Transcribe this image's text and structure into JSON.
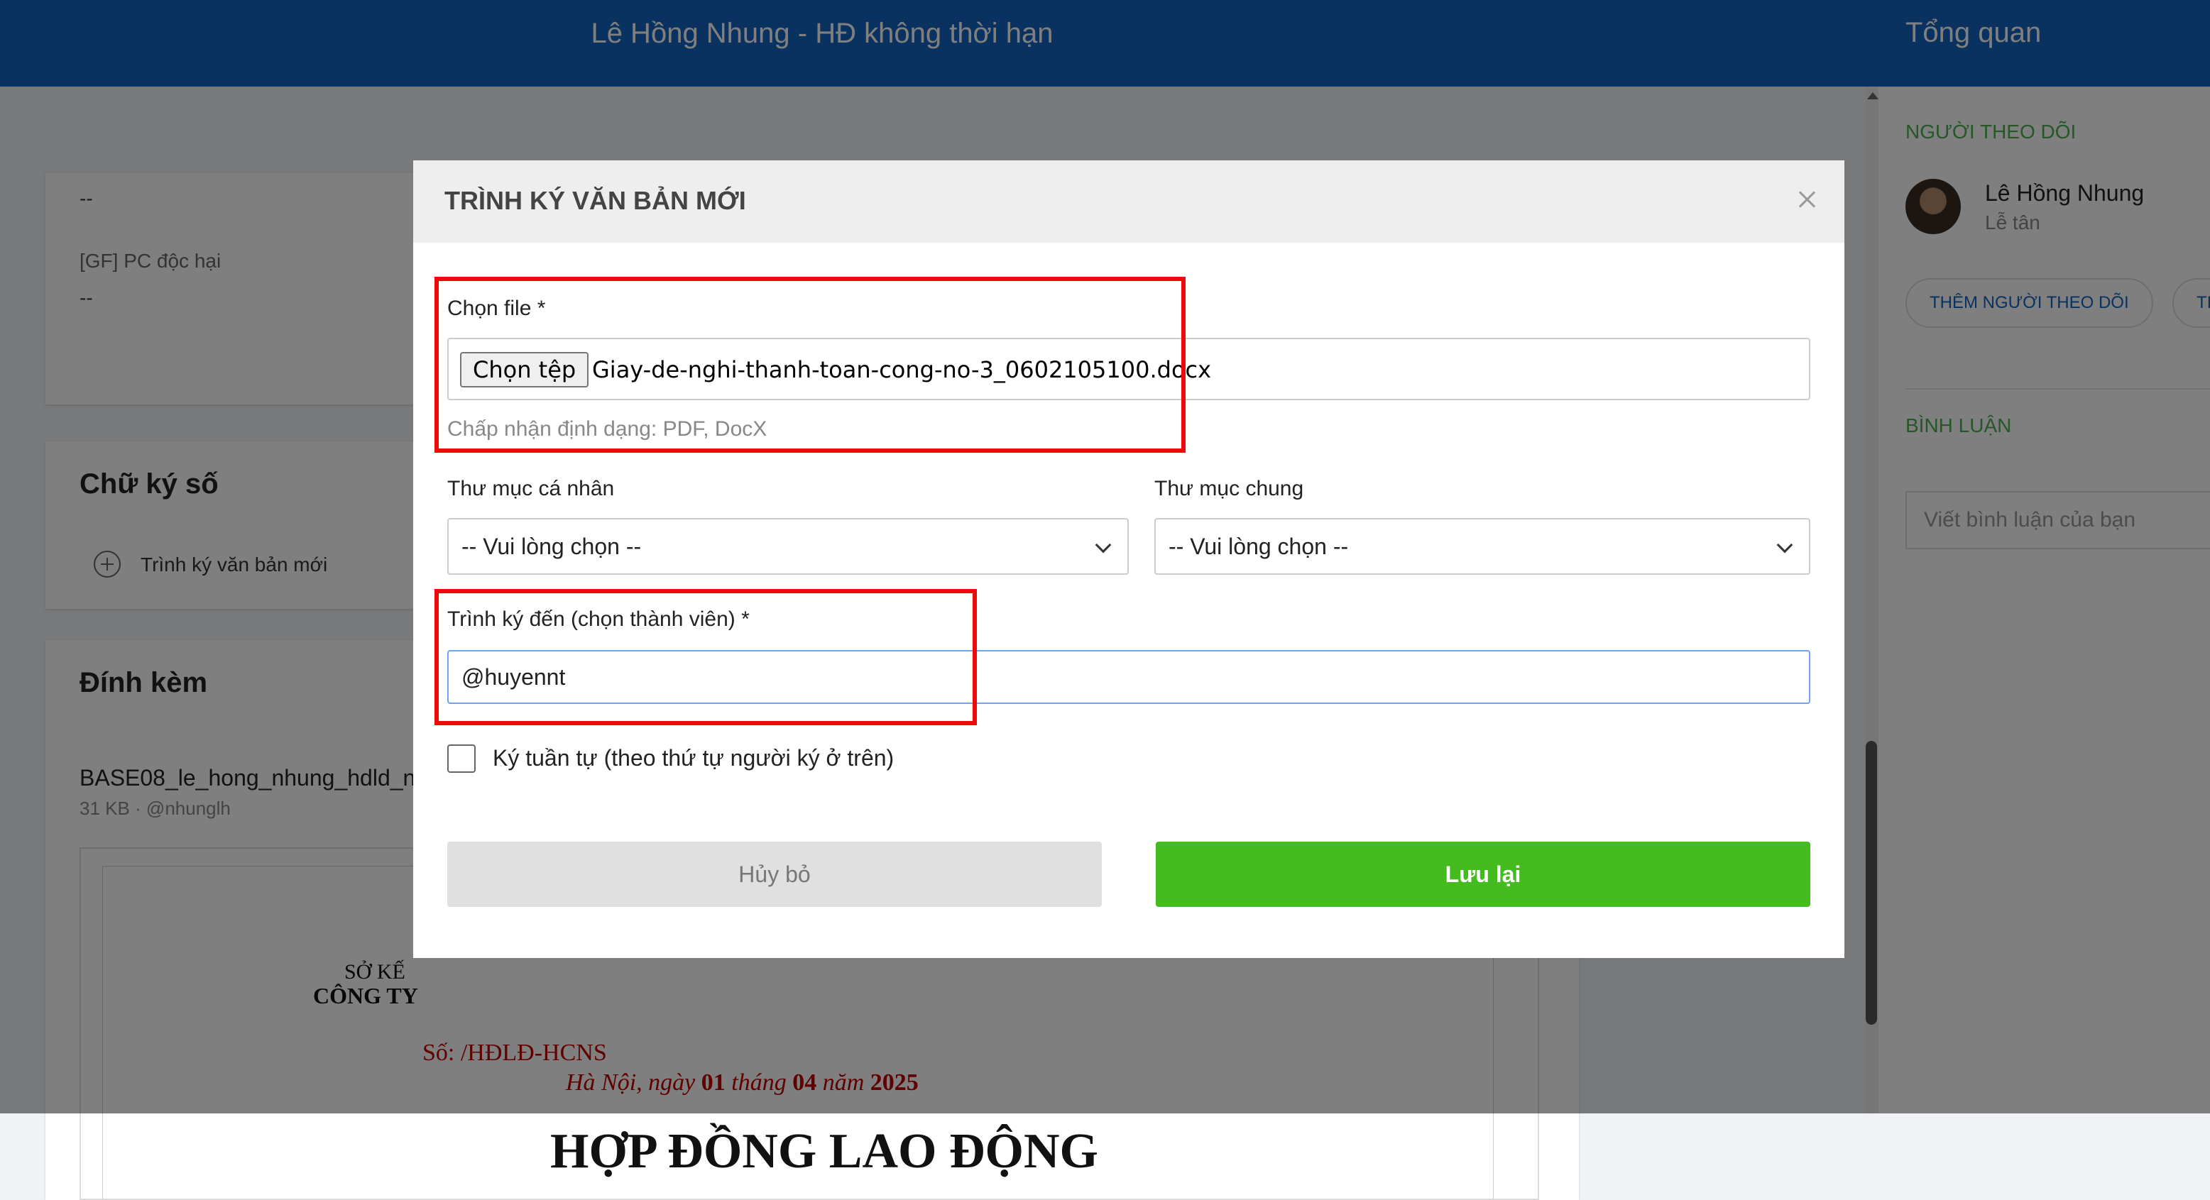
{
  "header": {
    "page_title": "Lê Hồng Nhung - HĐ không thời hạn",
    "right_title": "Tổng quan"
  },
  "background": {
    "field_values": [
      "--",
      "--"
    ],
    "pc_label": "[GF] PC độc hại",
    "pc_value": "--",
    "signature_section": {
      "title": "Chữ ký số",
      "add_label": "Trình ký văn bản mới"
    },
    "attachments": {
      "title": "Đính kèm",
      "file_name": "BASE08_le_hong_nhung_hdld_n",
      "file_meta": "31 KB · @nhunglh"
    },
    "doc_preview": {
      "line1": "SỞ KẾ",
      "line2": "CÔNG TY",
      "number": "Số: /HĐLĐ-HCNS",
      "date_prefix": "Hà Nội, ngày ",
      "day": "01",
      "month_prefix": " tháng ",
      "month": "04",
      "year_prefix": " năm ",
      "year": "2025",
      "heading": "HỢP ĐỒNG LAO ĐỘNG"
    }
  },
  "right_panel": {
    "followers_title": "NGƯỜI THEO DÕI",
    "follower": {
      "name": "Lê Hồng Nhung",
      "role": "Lễ tân"
    },
    "add_follower_label": "THÊM NGƯỜI THEO DÕI",
    "extra_pill_label": "TI",
    "comments_title": "BÌNH LUẬN",
    "comment_placeholder": "Viết bình luận của bạn"
  },
  "modal": {
    "title": "TRÌNH KÝ VĂN BẢN MỚI",
    "choose_file_label": "Chọn file *",
    "choose_file_button": "Chọn tệp",
    "chosen_file_name": "Giay-de-nghi-thanh-toan-cong-no-3_0602105100.docx",
    "accepted_formats": "Chấp nhận định dạng: PDF, DocX",
    "personal_folder_label": "Thư mục cá nhân",
    "personal_folder_value": "-- Vui lòng chọn --",
    "shared_folder_label": "Thư mục chung",
    "shared_folder_value": "-- Vui lòng chọn --",
    "sign_to_label": "Trình ký đến (chọn thành viên) *",
    "sign_to_value": "@huyennt",
    "sequential_label": "Ký tuần tự (theo thứ tự người ký ở trên)",
    "sequential_checked": false,
    "cancel_label": "Hủy bỏ",
    "save_label": "Lưu lại"
  },
  "colors": {
    "header_blue": "#1565c0",
    "save_green": "#44bb1e",
    "annotation_red": "#ee0a0a",
    "section_green": "#4caf50"
  }
}
